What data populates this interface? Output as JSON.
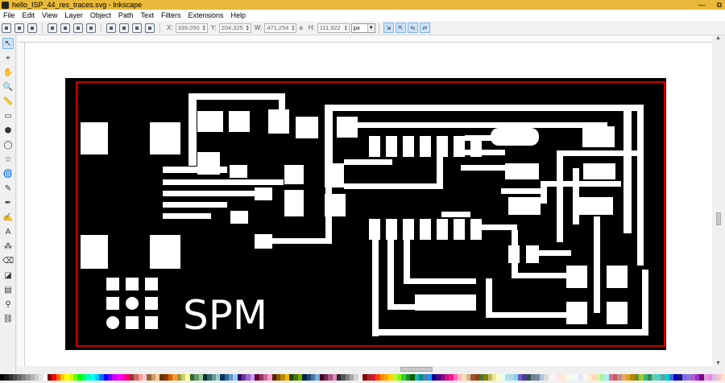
{
  "window": {
    "title": "hello_ISP_44_res_traces.svg - Inkscape",
    "min_glyph": "—",
    "restore_glyph": "⧉"
  },
  "menu": [
    "File",
    "Edit",
    "View",
    "Layer",
    "Object",
    "Path",
    "Text",
    "Filters",
    "Extensions",
    "Help"
  ],
  "toolbar": {
    "x_label": "X:",
    "x_value": "339,050",
    "y_label": "Y:",
    "y_value": "204,325",
    "w_label": "W:",
    "w_value": "471,254",
    "lock_glyph": "a",
    "h_label": "H:",
    "h_value": "111,922",
    "unit": "px"
  },
  "tools": [
    {
      "name": "selector-tool-icon",
      "glyph": "↖",
      "active": true
    },
    {
      "name": "node-tool-icon",
      "glyph": "⌖"
    },
    {
      "name": "tweak-tool-icon",
      "glyph": "✋"
    },
    {
      "name": "zoom-tool-icon",
      "glyph": "🔍"
    },
    {
      "name": "measure-tool-icon",
      "glyph": "📏"
    },
    {
      "name": "rect-tool-icon",
      "glyph": "▭"
    },
    {
      "name": "3dbox-tool-icon",
      "glyph": "⬢"
    },
    {
      "name": "ellipse-tool-icon",
      "glyph": "◯"
    },
    {
      "name": "star-tool-icon",
      "glyph": "☆"
    },
    {
      "name": "spiral-tool-icon",
      "glyph": "🌀"
    },
    {
      "name": "pencil-tool-icon",
      "glyph": "✎"
    },
    {
      "name": "pen-tool-icon",
      "glyph": "✒"
    },
    {
      "name": "calligraphy-tool-icon",
      "glyph": "✍"
    },
    {
      "name": "text-tool-icon",
      "glyph": "A"
    },
    {
      "name": "spray-tool-icon",
      "glyph": "⁂"
    },
    {
      "name": "eraser-tool-icon",
      "glyph": "⌫"
    },
    {
      "name": "bucket-tool-icon",
      "glyph": "◪"
    },
    {
      "name": "gradient-tool-icon",
      "glyph": "▤"
    },
    {
      "name": "dropper-tool-icon",
      "glyph": "⚲"
    },
    {
      "name": "connector-tool-icon",
      "glyph": "⛓"
    }
  ],
  "document": {
    "board_label": "SPM",
    "board_color": "#000000",
    "trace_color": "#ffffff",
    "border_color": "#cc0000"
  },
  "palette": [
    "#000000",
    "#1a1a1a",
    "#333333",
    "#4d4d4d",
    "#666666",
    "#808080",
    "#999999",
    "#b3b3b3",
    "#cccccc",
    "#e6e6e6",
    "#ffffff",
    "#800000",
    "#ff0000",
    "#ff6600",
    "#ffcc00",
    "#ffff00",
    "#ccff00",
    "#66ff00",
    "#00ff00",
    "#00ff66",
    "#00ffcc",
    "#00ffff",
    "#00ccff",
    "#0066ff",
    "#0000ff",
    "#6600ff",
    "#cc00ff",
    "#ff00ff",
    "#ff00cc",
    "#ff0066",
    "#993333",
    "#cc6666",
    "#ff9999",
    "#ffcccc",
    "#996633",
    "#cc9966",
    "#ffcc99",
    "#663300",
    "#993300",
    "#cc6600",
    "#ff9933",
    "#999933",
    "#cccc66",
    "#ffff99",
    "#336633",
    "#669966",
    "#99cc99",
    "#003333",
    "#336666",
    "#669999",
    "#99cccc",
    "#003366",
    "#336699",
    "#6699cc",
    "#99ccff",
    "#330066",
    "#663399",
    "#9966cc",
    "#cc99ff",
    "#660033",
    "#993366",
    "#cc6699",
    "#ff99cc",
    "#552200",
    "#885500",
    "#bb8800",
    "#eebb00",
    "#224400",
    "#447700",
    "#77aa00",
    "#002244",
    "#224477",
    "#4477aa",
    "#77aadd",
    "#440022",
    "#772255",
    "#aa5588",
    "#dd88bb",
    "#2b2b2b",
    "#555555",
    "#7f7f7f",
    "#aaaaaa",
    "#d4d4d4",
    "#f2f2f2",
    "#8b0000",
    "#b22222",
    "#dc143c",
    "#ff4500",
    "#ff8c00",
    "#ffa500",
    "#ffd700",
    "#adff2f",
    "#7fff00",
    "#32cd32",
    "#228b22",
    "#006400",
    "#20b2aa",
    "#008b8b",
    "#4682b4",
    "#1e90ff",
    "#00008b",
    "#4b0082",
    "#8b008b",
    "#c71585",
    "#ff1493",
    "#ff69b4",
    "#ffb6c1",
    "#f5deb3",
    "#d2b48c",
    "#a0522d",
    "#8b4513",
    "#556b2f",
    "#808000",
    "#bdb76b",
    "#f0e68c",
    "#fffacd",
    "#e0ffff",
    "#b0e0e6",
    "#add8e6",
    "#87ceeb",
    "#6a5acd",
    "#483d8b",
    "#2f4f4f",
    "#708090",
    "#778899",
    "#b0c4de",
    "#dcdcdc",
    "#f5f5f5",
    "#fff0f5",
    "#ffe4e1",
    "#faebd7",
    "#fdf5e6",
    "#f0fff0",
    "#f0f8ff",
    "#e6e6fa",
    "#fff5ee",
    "#ffefd5",
    "#ffdab9",
    "#eee8aa",
    "#98fb98",
    "#afeeee",
    "#db7093",
    "#cd5c5c",
    "#bc8f8f",
    "#f4a460",
    "#daa520",
    "#b8860b",
    "#6b8e23",
    "#9acd32",
    "#3cb371",
    "#2e8b57",
    "#66cdaa",
    "#48d1cc",
    "#5f9ea0",
    "#00ced1",
    "#4169e1",
    "#0000cd",
    "#191970",
    "#7b68ee",
    "#9370db",
    "#ba55d3",
    "#9932cc",
    "#800080",
    "#dda0dd",
    "#ee82ee",
    "#d8bfd8",
    "#ffc0cb",
    "#ffe4c4"
  ]
}
